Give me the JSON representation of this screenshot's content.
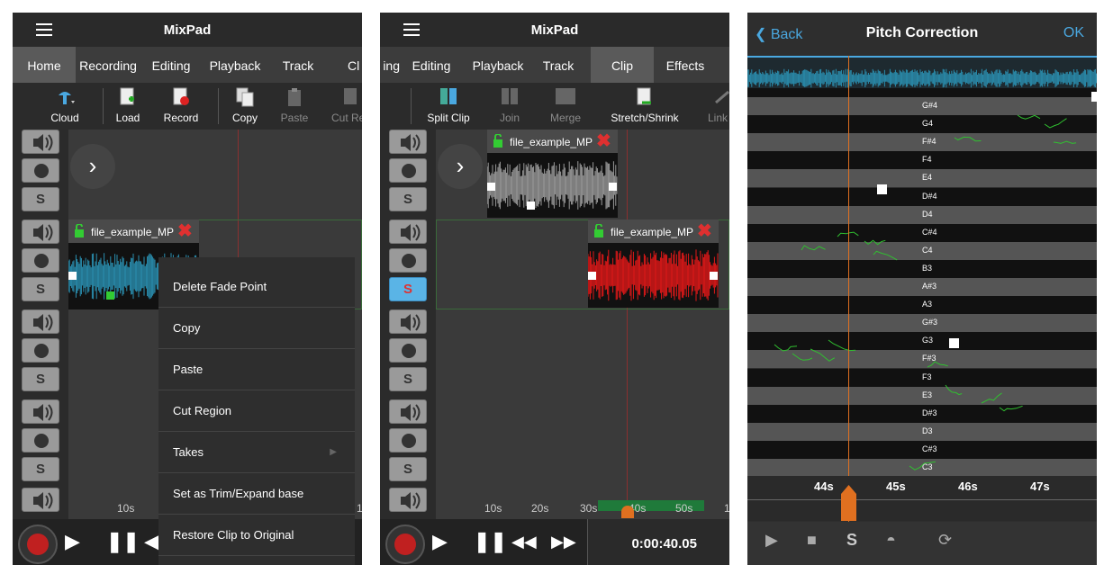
{
  "panel1": {
    "app_title": "MixPad",
    "tabs": [
      "Home",
      "Recording",
      "Editing",
      "Playback",
      "Track",
      "Cl"
    ],
    "tools": [
      "Cloud",
      "Load",
      "Record",
      "Copy",
      "Paste",
      "Cut Re"
    ],
    "clip_name": "file_example_MP",
    "timeline": [
      "10s",
      "1"
    ],
    "context_menu": [
      "Delete Fade Point",
      "Copy",
      "Paste",
      "Cut Region",
      "Takes",
      "Set as Trim/Expand base",
      "Restore Clip to Original"
    ]
  },
  "panel2": {
    "app_title": "MixPad",
    "tabs": [
      "ing",
      "Editing",
      "Playback",
      "Track",
      "Clip",
      "Effects"
    ],
    "tools": [
      "Split Clip",
      "Join",
      "Merge",
      "Stretch/Shrink",
      "Link"
    ],
    "clip1_name": "file_example_MP",
    "clip2_name": "file_example_MP",
    "timeline": [
      "10s",
      "20s",
      "30s",
      "40s",
      "50s",
      "1"
    ],
    "time_display": "0:00:40.05"
  },
  "panel3": {
    "back": "Back",
    "title": "Pitch Correction",
    "ok": "OK",
    "notes": [
      "G#4",
      "G4",
      "F#4",
      "F4",
      "E4",
      "D#4",
      "D4",
      "C#4",
      "C4",
      "B3",
      "A#3",
      "A3",
      "G#3",
      "G3",
      "F#3",
      "F3",
      "E3",
      "D#3",
      "D3",
      "C#3",
      "C3"
    ],
    "timeline": [
      "44s",
      "45s",
      "46s",
      "47s"
    ]
  },
  "colors": {
    "accent": "#4aa8e0",
    "waveform_blue": "#2a8fb0",
    "waveform_red": "#e01818",
    "waveform_gray": "#9a9a9a",
    "playhead_orange": "#e07020",
    "pitch_green": "#30c030"
  }
}
